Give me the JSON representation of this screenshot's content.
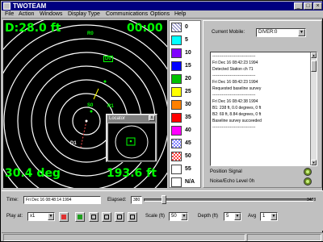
{
  "window": {
    "title": "TWOTEAM"
  },
  "menu": [
    "File",
    "Action",
    "Windows",
    "Display Type",
    "Communications",
    "Options",
    "Help"
  ],
  "sonar": {
    "depth_readout": "D:28.0 ft",
    "time_readout": "00:00",
    "bearing_readout": "30.4 deg",
    "range_readout": "193.6 ft",
    "markers": [
      "R0",
      "D0",
      "S0",
      "R1",
      "D1"
    ]
  },
  "locator": {
    "title": "Locator",
    "close": "x"
  },
  "legend": {
    "items": [
      {
        "label": "0",
        "color": "#ffffff",
        "pattern": "hatch"
      },
      {
        "label": "5",
        "color": "#00ffff"
      },
      {
        "label": "10",
        "color": "#8000ff"
      },
      {
        "label": "15",
        "color": "#0000ff"
      },
      {
        "label": "20",
        "color": "#00c000"
      },
      {
        "label": "25",
        "color": "#ffff00"
      },
      {
        "label": "30",
        "color": "#ff8000"
      },
      {
        "label": "35",
        "color": "#ff0000"
      },
      {
        "label": "40",
        "color": "#ff00ff"
      },
      {
        "label": "45",
        "color": "#8080ff",
        "pattern": "check"
      },
      {
        "label": "50",
        "color": "#ff4040",
        "pattern": "check"
      },
      {
        "label": "55",
        "color": "#ffffff",
        "pattern": "check"
      },
      {
        "label": "N/A",
        "color": "#ffffff"
      }
    ]
  },
  "panel": {
    "mobile_label": "Current Mobile:",
    "mobile_value": "DIVER:0",
    "log": [
      "--------------------------------",
      "Fri Dec 16 08:42:23 1994",
      "Detected Station ch 71",
      "--------------------------------",
      "Fri Dec 16 08:42:23 1994",
      "Requested baseline survey",
      "--------------------------------",
      "Fri Dec 16 08:42:38 1994",
      "B1: 238 ft, 0.0 degrees, 0 ft",
      "B2: 69 ft, 8.84 degrees, 0 ft",
      "Baseline survey succeeded",
      "--------------------------------"
    ],
    "position_signal": "Position Signal",
    "noise_level": "Noise/Echo Level 0h"
  },
  "controls": {
    "time_label": "Time:",
    "time_value": "Fri Dec 16 08:48:14 1994",
    "elapsed_label": "Elapsed:",
    "elapsed_value": "380",
    "elapsed_max": "3428",
    "elapsed_fraction": 0.11,
    "playat_label": "Play at:",
    "playat_value": "x1",
    "scale_label": "Scale (ft)",
    "scale_value": "50",
    "depth_label": "Depth (ft)",
    "depth_value": "5",
    "avg_label": "Avg",
    "avg_value": "1"
  }
}
